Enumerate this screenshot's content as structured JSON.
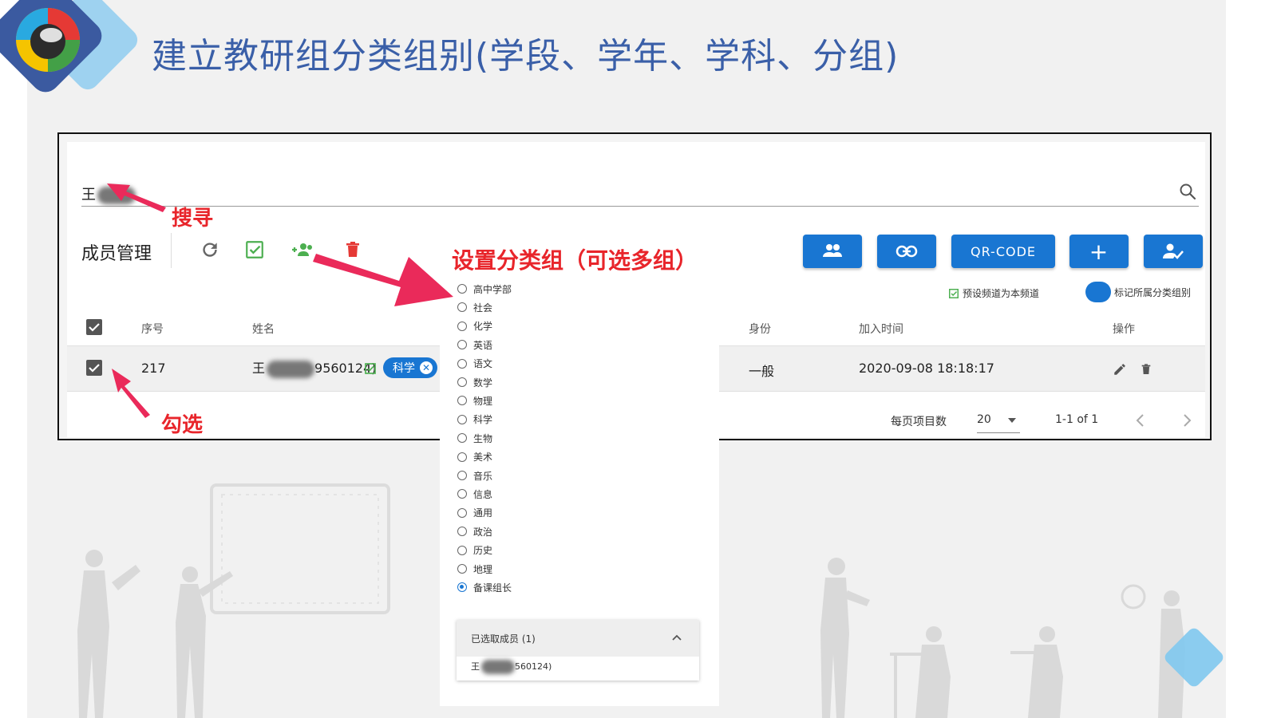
{
  "slide": {
    "title": "建立教研组分类组别(学段、学年、学科、分组)"
  },
  "search": {
    "value": "王"
  },
  "toolbar": {
    "title": "成员管理",
    "buttons": {
      "members": "members",
      "link": "link",
      "qrcode": "QR-CODE",
      "add": "+",
      "assign": "assign"
    }
  },
  "flags": {
    "preset_channel": "预设频道为本频道",
    "mark_group": "标记所属分类组别"
  },
  "table": {
    "headers": {
      "index": "序号",
      "name": "姓名",
      "role": "身份",
      "joined": "加入时间",
      "actions": "操作"
    },
    "rows": [
      {
        "index": "217",
        "name_prefix": "王",
        "name_suffix": "9560124)",
        "tag": "科学",
        "role": "一般",
        "joined": "2020-09-08 18:18:17"
      }
    ]
  },
  "pagination": {
    "per_page_label": "每页项目数",
    "per_page_value": "20",
    "range": "1-1 of 1"
  },
  "annotations": {
    "search": "搜寻",
    "set_group": "设置分类组（可选多组）",
    "check": "勾选"
  },
  "group_options": [
    {
      "label": "高中学部",
      "selected": false
    },
    {
      "label": "社会",
      "selected": false
    },
    {
      "label": "化学",
      "selected": false
    },
    {
      "label": "英语",
      "selected": false
    },
    {
      "label": "语文",
      "selected": false
    },
    {
      "label": "数学",
      "selected": false
    },
    {
      "label": "物理",
      "selected": false
    },
    {
      "label": "科学",
      "selected": false
    },
    {
      "label": "生物",
      "selected": false
    },
    {
      "label": "美术",
      "selected": false
    },
    {
      "label": "音乐",
      "selected": false
    },
    {
      "label": "信息",
      "selected": false
    },
    {
      "label": "通用",
      "selected": false
    },
    {
      "label": "政治",
      "selected": false
    },
    {
      "label": "历史",
      "selected": false
    },
    {
      "label": "地理",
      "selected": false
    },
    {
      "label": "备课组长",
      "selected": true
    }
  ],
  "selected_panel": {
    "title": "已选取成员 (1)",
    "member_prefix": "王",
    "member_suffix": "560124)"
  },
  "colors": {
    "primary": "#1976d2",
    "annotation": "#e8252b",
    "title": "#3a5fa8",
    "success": "#4caf50",
    "danger": "#e53935"
  }
}
